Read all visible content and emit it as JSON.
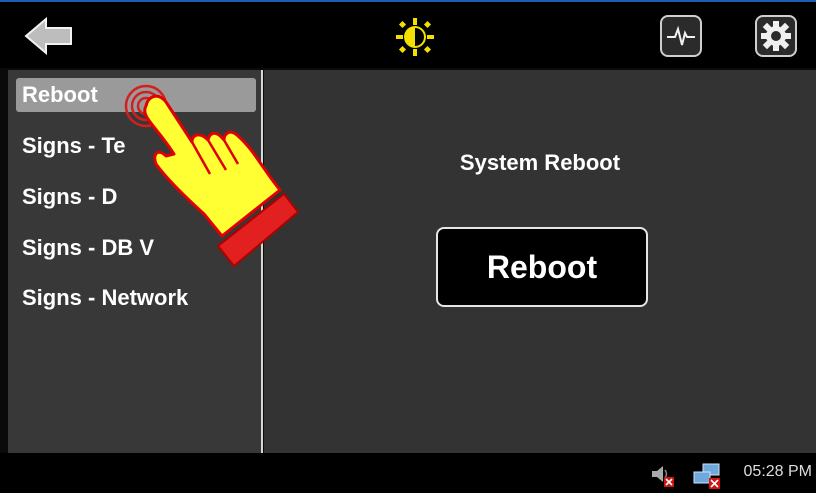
{
  "toolbar": {
    "back_icon": "back-arrow-icon",
    "brightness_icon": "brightness-icon",
    "monitor_icon": "heartbeat-monitor-icon",
    "settings_icon": "gear-icon"
  },
  "sidebar": {
    "items": [
      {
        "label": "Reboot",
        "active": true
      },
      {
        "label": "Signs - Te"
      },
      {
        "label": "Signs - D"
      },
      {
        "label": "Signs - DB V"
      },
      {
        "label": "Signs - Network"
      }
    ]
  },
  "main": {
    "title": "System Reboot",
    "button_label": "Reboot"
  },
  "statusbar": {
    "volume_icon": "volume-muted-icon",
    "network_icon": "network-disconnected-icon",
    "time": "05:28 PM"
  },
  "overlay": {
    "icon": "tap-hand-icon"
  },
  "colors": {
    "accent_top_border": "#1e5fb3",
    "brightness": "#f3e000",
    "hand_fill": "#ffff33",
    "hand_stroke": "#e00000"
  }
}
